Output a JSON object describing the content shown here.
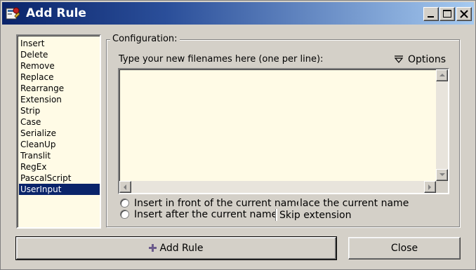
{
  "window": {
    "title": "Add Rule",
    "buttons": {
      "minimize": "minimize-icon",
      "maximize": "maximize-icon",
      "close": "close-icon"
    }
  },
  "rules_list": {
    "items": [
      "Insert",
      "Delete",
      "Remove",
      "Replace",
      "Rearrange",
      "Extension",
      "Strip",
      "Case",
      "Serialize",
      "CleanUp",
      "Translit",
      "RegEx",
      "PascalScript",
      "UserInput"
    ],
    "selected": "UserInput"
  },
  "configuration": {
    "group_label": "Configuration:",
    "hint": "Type your new filenames here (one per line):",
    "options_label": "Options",
    "memo_value": "",
    "radio_insert_front": "Insert in front of the current name",
    "radio_replace": "lace the current name",
    "radio_insert_after": "Insert after the current name",
    "checkbox_skip_extension": "Skip extension"
  },
  "footer": {
    "add_rule_label": "Add Rule",
    "close_label": "Close"
  },
  "colors": {
    "title_start": "#0a246a",
    "selection": "#0a246a",
    "list_bg": "#fffbe6",
    "face": "#d4d0c8"
  }
}
